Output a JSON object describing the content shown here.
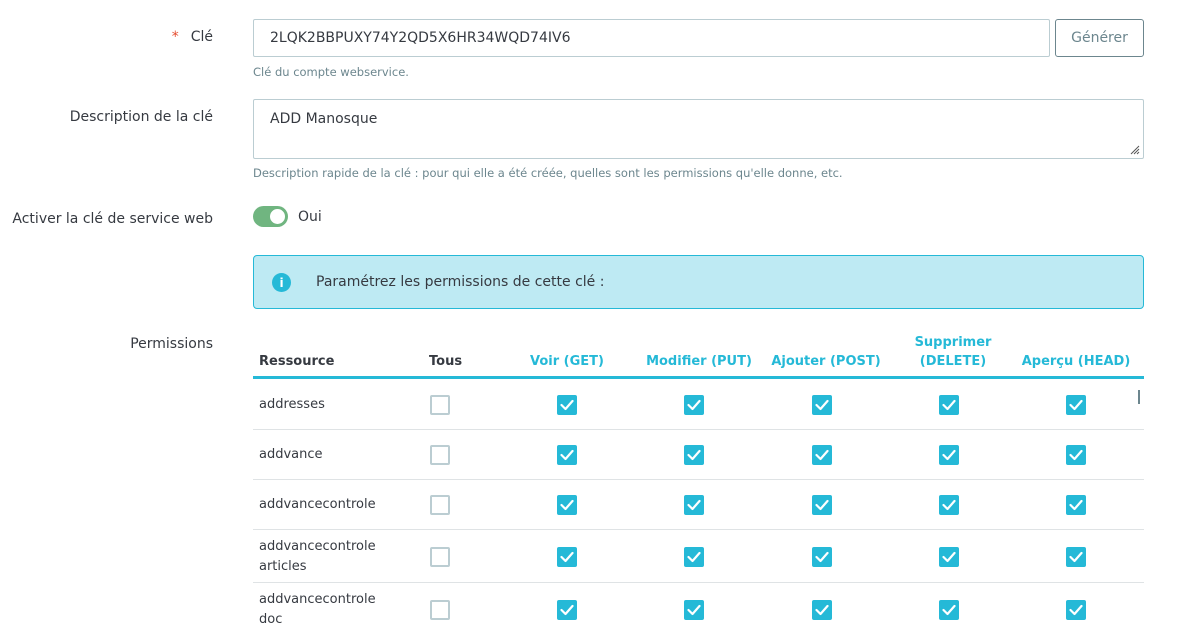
{
  "key": {
    "label": "Clé",
    "required_mark": "*",
    "value": "2LQK2BBPUXY74Y2QD5X6HR34WQD74IV6",
    "generate_button": "Générer",
    "help": "Clé du compte webservice."
  },
  "description": {
    "label": "Description de la clé",
    "value": "ADD Manosque",
    "help": "Description rapide de la clé : pour qui elle a été créée, quelles sont les permissions qu'elle donne, etc."
  },
  "activate": {
    "label": "Activer la clé de service web",
    "state": "Oui",
    "enabled": true
  },
  "info": {
    "icon": "info-icon",
    "text": "Paramétrez les permissions de cette clé :"
  },
  "permissions": {
    "label": "Permissions",
    "columns": {
      "resource": "Ressource",
      "all": "Tous",
      "get": "Voir (GET)",
      "put": "Modifier (PUT)",
      "post": "Ajouter (POST)",
      "delete_line1": "Supprimer",
      "delete_line2": "(DELETE)",
      "head": "Aperçu (HEAD)"
    },
    "rows": [
      {
        "name": "addresses",
        "all": false,
        "get": true,
        "put": true,
        "post": true,
        "delete": true,
        "head": true
      },
      {
        "name": "addvance",
        "all": false,
        "get": true,
        "put": true,
        "post": true,
        "delete": true,
        "head": true
      },
      {
        "name": "addvancecontrole",
        "all": false,
        "get": true,
        "put": true,
        "post": true,
        "delete": true,
        "head": true
      },
      {
        "name": "addvancecontrole articles",
        "line1": "addvancecontrole",
        "line2": "articles",
        "all": false,
        "get": true,
        "put": true,
        "post": true,
        "delete": true,
        "head": true
      },
      {
        "name": "addvancecontrole doc",
        "line1": "addvancecontrole",
        "line2": "doc",
        "all": false,
        "get": true,
        "put": true,
        "post": true,
        "delete": true,
        "head": true
      }
    ]
  },
  "colors": {
    "accent": "#25b9d7",
    "toggle_on": "#70b580",
    "required": "#e54b2e",
    "alert_bg": "#beeaf3"
  }
}
